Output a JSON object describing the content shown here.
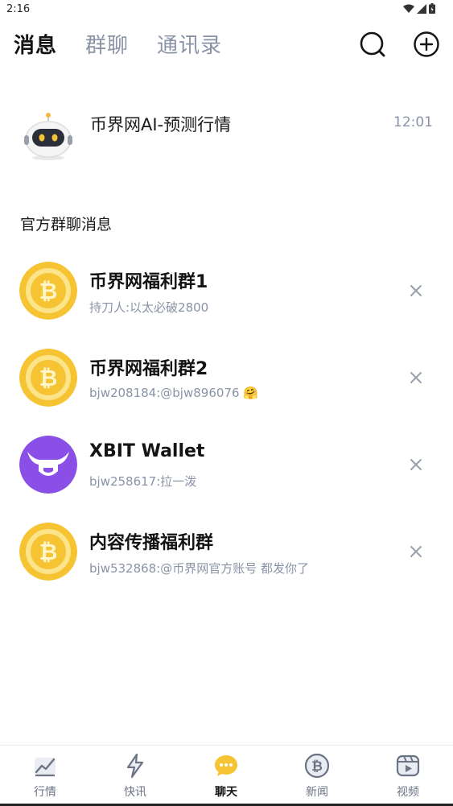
{
  "status_bar": {
    "time": "2:16"
  },
  "header": {
    "tabs": [
      {
        "label": "消息",
        "active": true
      },
      {
        "label": "群聊",
        "active": false
      },
      {
        "label": "通讯录",
        "active": false
      }
    ],
    "icons": [
      "search-icon",
      "add-circle-icon"
    ]
  },
  "ai_chat": {
    "title": "币界网AI-预测行情",
    "time": "12:01",
    "icon": "robot-avatar"
  },
  "section_title": "官方群聊消息",
  "groups": [
    {
      "name": "币界网福利群1",
      "preview": "持刀人:以太必破2800",
      "avatar": "bitcoin-coin-avatar"
    },
    {
      "name": "币界网福利群2",
      "preview": "bjw208184:@bjw896076 🤗",
      "avatar": "bitcoin-coin-avatar"
    },
    {
      "name": "XBIT Wallet",
      "preview": "bjw258617:拉一泼",
      "avatar": "xbit-bull-avatar"
    },
    {
      "name": "内容传播福利群",
      "preview": "bjw532868:@币界网官方账号 都发你了",
      "avatar": "bitcoin-coin-avatar"
    }
  ],
  "tabbar": [
    {
      "label": "行情",
      "icon": "chart-icon",
      "active": false
    },
    {
      "label": "快讯",
      "icon": "lightning-icon",
      "active": false
    },
    {
      "label": "聊天",
      "icon": "chat-bubble-icon",
      "active": true
    },
    {
      "label": "新闻",
      "icon": "bitcoin-news-icon",
      "active": false
    },
    {
      "label": "视频",
      "icon": "video-icon",
      "active": false
    }
  ],
  "colors": {
    "accent": "#f6c333",
    "muted": "#8a93a6",
    "purple": "#8a4fe6"
  }
}
